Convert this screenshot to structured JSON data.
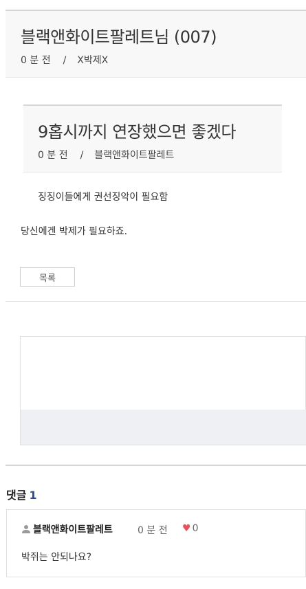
{
  "post": {
    "title": "블랙앤화이트팔레트님 (007)",
    "time": "0 분 전",
    "separator": "/",
    "author": "X박제X"
  },
  "quote": {
    "title": "9홉시까지 연장했으면 좋겠다",
    "time": "0 분 전",
    "separator": "/",
    "author": "블랙앤화이트팔레트",
    "body": "징징이들에게 권선징악이 필요함"
  },
  "body": "당신에겐 박제가 필요하죠.",
  "list_button": "목록",
  "comments": {
    "heading": "댓글",
    "count": "1",
    "items": [
      {
        "author": "블랙앤화이트팔레트",
        "time": "0 분 전",
        "likes": "0",
        "text": "박쥐는 안되나요?"
      }
    ]
  },
  "colors": {
    "accent": "#2d4b8e",
    "heart": "#e8505b",
    "header_bg": "#f8f8f8",
    "ad_bottom": "#eff0f4"
  },
  "icons": {
    "user": "user-icon",
    "like": "heart-icon"
  }
}
